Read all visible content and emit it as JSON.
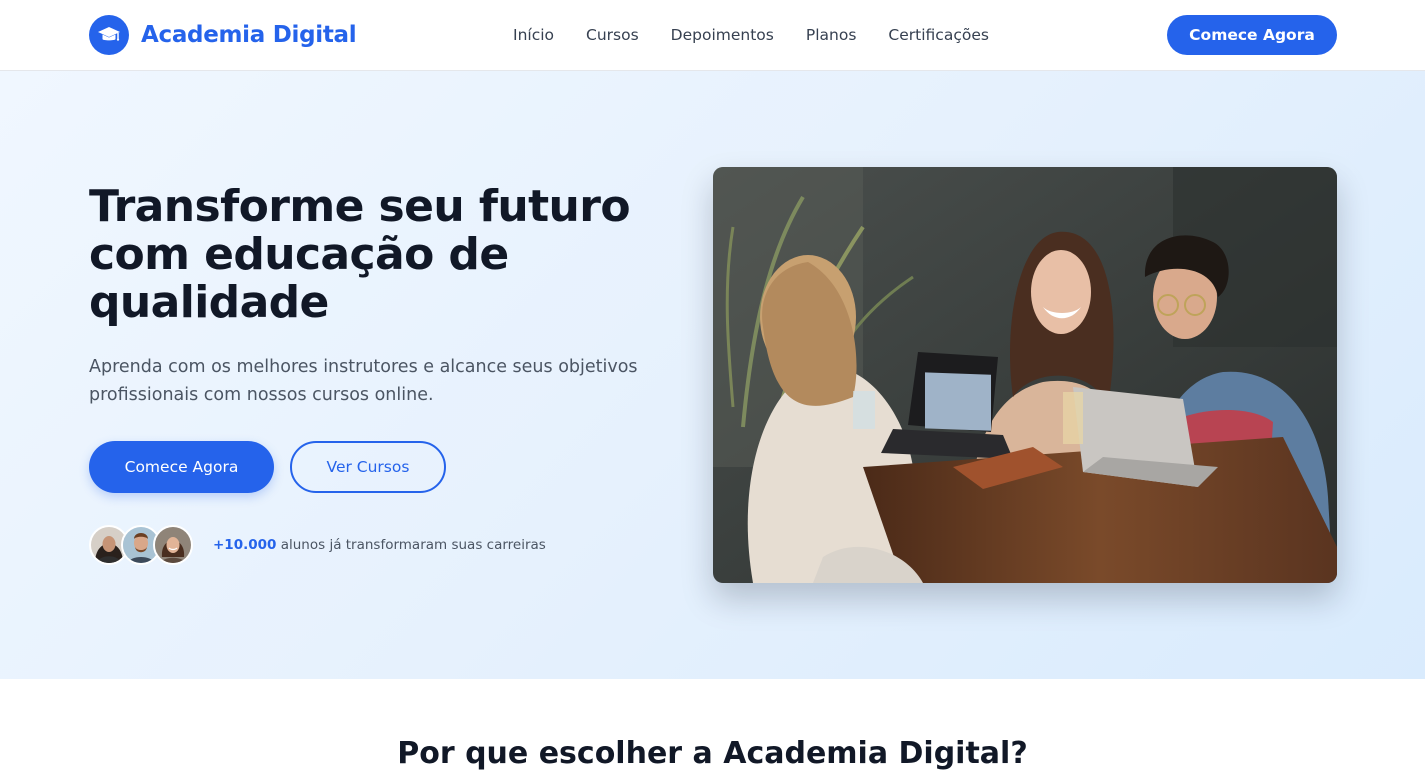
{
  "brand": {
    "name": "Academia Digital",
    "icon": "graduation-cap-icon",
    "color": "#2563eb"
  },
  "nav": {
    "links": [
      "Início",
      "Cursos",
      "Depoimentos",
      "Planos",
      "Certificações"
    ],
    "cta_label": "Comece Agora"
  },
  "hero": {
    "title": "Transforme seu futuro com educação de qualidade",
    "subtitle": "Aprenda com os melhores instrutores e alcance seus objetivos profissionais com nossos cursos online.",
    "primary_button": "Comece Agora",
    "secondary_button": "Ver Cursos",
    "social_proof": {
      "count": "+10.000",
      "text": "alunos já transformaram suas carreiras"
    },
    "image": "students-laptops-photo"
  },
  "section": {
    "title": "Por que escolher a Academia Digital?"
  },
  "colors": {
    "accent": "#2563eb",
    "heading": "#111827",
    "body": "#4b5563",
    "hero_bg": "#e6f1fd"
  }
}
